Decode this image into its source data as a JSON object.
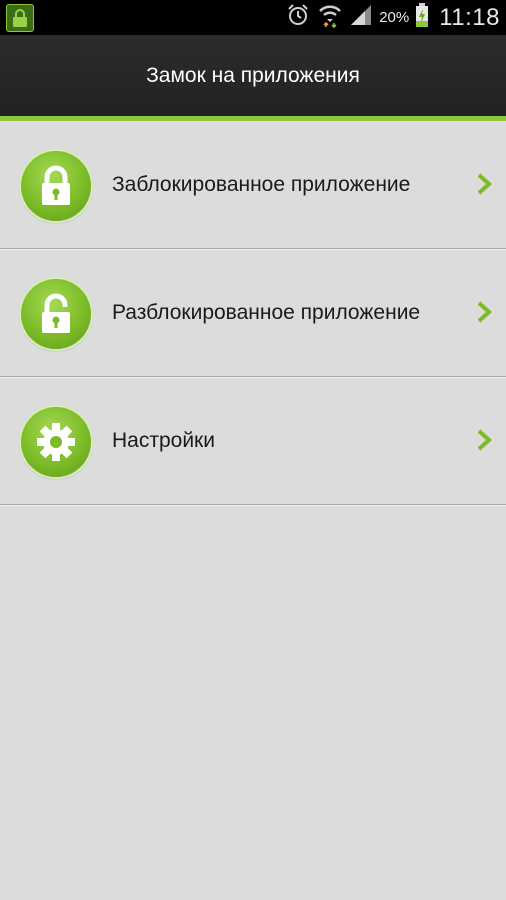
{
  "status_bar": {
    "battery_percent": "20%",
    "time": "11:18",
    "icons": [
      "app-lock-notification-icon",
      "alarm-icon",
      "wifi-icon",
      "signal-icon",
      "battery-charging-icon"
    ]
  },
  "action_bar": {
    "title": "Замок на приложения"
  },
  "menu": {
    "items": [
      {
        "label": "Заблокированное приложение",
        "icon": "locked-padlock-icon"
      },
      {
        "label": "Разблокированное приложение",
        "icon": "unlocked-padlock-icon"
      },
      {
        "label": "Настройки",
        "icon": "settings-gear-icon"
      }
    ]
  },
  "colors": {
    "accent": "#8dc63f",
    "actionbar_bg": "#262626",
    "page_bg": "#dcdcdc",
    "icon_green": "#7cbb28"
  }
}
